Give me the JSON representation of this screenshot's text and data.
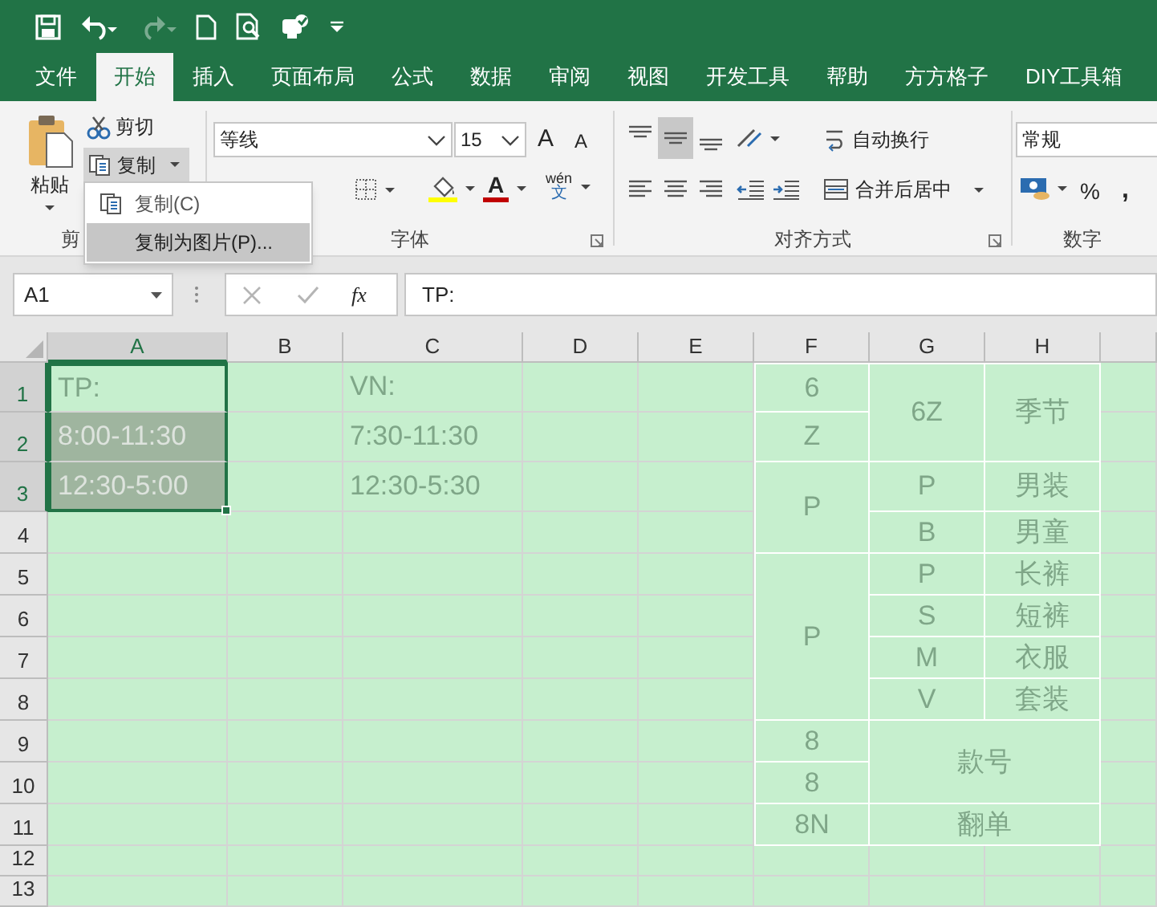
{
  "quick_access": [
    {
      "kind": "save",
      "disabled": false
    },
    {
      "kind": "undo",
      "disabled": false
    },
    {
      "kind": "redo",
      "disabled": true
    },
    {
      "kind": "new",
      "disabled": false
    },
    {
      "kind": "preview",
      "disabled": false
    },
    {
      "kind": "touch",
      "disabled": false
    },
    {
      "kind": "customize",
      "disabled": false
    }
  ],
  "tabs": [
    {
      "label": "文件",
      "selected": false
    },
    {
      "label": "开始",
      "selected": true
    },
    {
      "label": "插入",
      "selected": false
    },
    {
      "label": "页面布局",
      "selected": false
    },
    {
      "label": "公式",
      "selected": false
    },
    {
      "label": "数据",
      "selected": false
    },
    {
      "label": "审阅",
      "selected": false
    },
    {
      "label": "视图",
      "selected": false
    },
    {
      "label": "开发工具",
      "selected": false
    },
    {
      "label": "帮助",
      "selected": false
    },
    {
      "label": "方方格子",
      "selected": false
    },
    {
      "label": "DIY工具箱",
      "selected": false
    }
  ],
  "clipboard": {
    "paste_label": "粘贴",
    "cut_label": "剪切",
    "copy_label": "复制",
    "copy_expanded": true,
    "group_label": "剪"
  },
  "copy_menu": [
    {
      "label": "复制(C)",
      "selected": false
    },
    {
      "label": "复制为图片(P)...",
      "selected": true
    }
  ],
  "font": {
    "font_name": "等线",
    "font_size": "15",
    "grow_glyph": "A",
    "shrink_glyph": "A",
    "font_color_glyph": "A",
    "phonetic_top": "wén",
    "phonetic_bottom": "文",
    "group_label": "字体"
  },
  "alignment": {
    "vertical_buttons": [
      {
        "kind": "top",
        "selected": false
      },
      {
        "kind": "middle",
        "selected": true
      },
      {
        "kind": "bottom",
        "selected": false
      }
    ],
    "wrap_label": "自动换行",
    "merge_label": "合并后居中",
    "group_label": "对齐方式"
  },
  "number": {
    "format": "常规",
    "percent": "%",
    "comma": ",",
    "group_label": "数字"
  },
  "formula_bar": {
    "name_box": "A1",
    "fx_label": "fx",
    "formula": "TP:"
  },
  "columns": [
    {
      "label": "A",
      "selected": true
    },
    {
      "label": "B",
      "selected": false
    },
    {
      "label": "C",
      "selected": false
    },
    {
      "label": "D",
      "selected": false
    },
    {
      "label": "E",
      "selected": false
    },
    {
      "label": "F",
      "selected": false
    },
    {
      "label": "G",
      "selected": false
    },
    {
      "label": "H",
      "selected": false
    }
  ],
  "rows": [
    {
      "label": "1",
      "selected": true
    },
    {
      "label": "2",
      "selected": true
    },
    {
      "label": "3",
      "selected": true
    },
    {
      "label": "4",
      "selected": false
    },
    {
      "label": "5",
      "selected": false
    },
    {
      "label": "6",
      "selected": false
    },
    {
      "label": "7",
      "selected": false
    },
    {
      "label": "8",
      "selected": false
    },
    {
      "label": "9",
      "selected": false
    },
    {
      "label": "10",
      "selected": false
    },
    {
      "label": "11",
      "selected": false
    },
    {
      "label": "12",
      "selected": false
    },
    {
      "label": "13",
      "selected": false
    }
  ],
  "cells": [
    {
      "text": "TP:",
      "selected": true,
      "active": true
    },
    {
      "text": "VN:",
      "selected": false,
      "active": false
    },
    {
      "text": "6",
      "selected": false,
      "active": false
    },
    {
      "text": "6Z",
      "selected": false,
      "active": false
    },
    {
      "text": "季节",
      "selected": false,
      "active": false
    },
    {
      "text": "8:00-11:30",
      "selected": true,
      "active": false
    },
    {
      "text": "7:30-11:30",
      "selected": false,
      "active": false
    },
    {
      "text": "Z",
      "selected": false,
      "active": false
    },
    {
      "text": "12:30-5:00",
      "selected": true,
      "active": false
    },
    {
      "text": "12:30-5:30",
      "selected": false,
      "active": false
    },
    {
      "text": "P",
      "selected": false,
      "active": false
    },
    {
      "text": "P",
      "selected": false,
      "active": false
    },
    {
      "text": "男装",
      "selected": false,
      "active": false
    },
    {
      "text": "B",
      "selected": false,
      "active": false
    },
    {
      "text": "男童",
      "selected": false,
      "active": false
    },
    {
      "text": "P",
      "selected": false,
      "active": false
    },
    {
      "text": "P",
      "selected": false,
      "active": false
    },
    {
      "text": "长裤",
      "selected": false,
      "active": false
    },
    {
      "text": "S",
      "selected": false,
      "active": false
    },
    {
      "text": "短裤",
      "selected": false,
      "active": false
    },
    {
      "text": "M",
      "selected": false,
      "active": false
    },
    {
      "text": "衣服",
      "selected": false,
      "active": false
    },
    {
      "text": "V",
      "selected": false,
      "active": false
    },
    {
      "text": "套装",
      "selected": false,
      "active": false
    },
    {
      "text": "8",
      "selected": false,
      "active": false
    },
    {
      "text": "款号",
      "selected": false,
      "active": false
    },
    {
      "text": "8",
      "selected": false,
      "active": false
    },
    {
      "text": "8N",
      "selected": false,
      "active": false
    },
    {
      "text": "翻单",
      "selected": false,
      "active": false
    }
  ]
}
